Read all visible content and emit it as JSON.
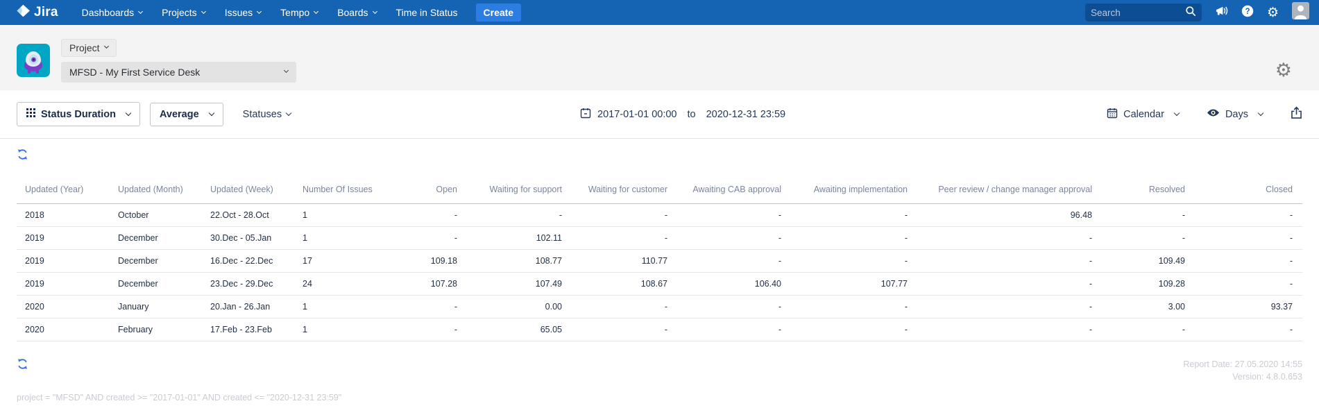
{
  "nav": {
    "logo_text": "Jira",
    "items": [
      {
        "label": "Dashboards"
      },
      {
        "label": "Projects"
      },
      {
        "label": "Issues"
      },
      {
        "label": "Tempo"
      },
      {
        "label": "Boards"
      },
      {
        "label": "Time in Status"
      }
    ],
    "create_label": "Create",
    "search_placeholder": "Search"
  },
  "banner": {
    "scope_label": "Project",
    "project_select_value": "MFSD - My First Service Desk"
  },
  "toolbar": {
    "report_type_label": "Status Duration",
    "aggregation_label": "Average",
    "statuses_label": "Statuses",
    "date_from": "2017-01-01 00:00",
    "date_to_word": "to",
    "date_to": "2020-12-31 23:59",
    "calendar_label": "Calendar",
    "unit_label": "Days"
  },
  "table": {
    "columns": [
      "Updated (Year)",
      "Updated (Month)",
      "Updated (Week)",
      "Number Of Issues",
      "Open",
      "Waiting for support",
      "Waiting for customer",
      "Awaiting CAB approval",
      "Awaiting implementation",
      "Peer review / change manager approval",
      "Resolved",
      "Closed"
    ],
    "rows": [
      [
        "2018",
        "October",
        "22.Oct - 28.Oct",
        "1",
        "-",
        "-",
        "-",
        "-",
        "-",
        "96.48",
        "-",
        "-"
      ],
      [
        "2019",
        "December",
        "30.Dec - 05.Jan",
        "1",
        "-",
        "102.11",
        "-",
        "-",
        "-",
        "-",
        "-",
        "-"
      ],
      [
        "2019",
        "December",
        "16.Dec - 22.Dec",
        "17",
        "109.18",
        "108.77",
        "110.77",
        "-",
        "-",
        "-",
        "109.49",
        "-"
      ],
      [
        "2019",
        "December",
        "23.Dec - 29.Dec",
        "24",
        "107.28",
        "107.49",
        "108.67",
        "106.40",
        "107.77",
        "-",
        "109.28",
        "-"
      ],
      [
        "2020",
        "January",
        "20.Jan - 26.Jan",
        "1",
        "-",
        "0.00",
        "-",
        "-",
        "-",
        "-",
        "3.00",
        "93.37"
      ],
      [
        "2020",
        "February",
        "17.Feb - 23.Feb",
        "1",
        "-",
        "65.05",
        "-",
        "-",
        "-",
        "-",
        "-",
        "-"
      ]
    ]
  },
  "footer": {
    "report_date": "Report Date: 27.05.2020 14:55",
    "version": "Version: 4.8.0.653",
    "jql": "project = \"MFSD\" AND created >= \"2017-01-01\" AND created <= \"2020-12-31 23:59\""
  },
  "icons": {
    "jira_logo": "jira-mark",
    "search": "magnifier",
    "announce": "megaphone",
    "help": "question-circle",
    "settings": "gear ⚙",
    "avatar": "person-silhouette",
    "report_type": "grid-3x3",
    "date": "calendar",
    "calendar_mode": "calendar",
    "unit": "eye",
    "export": "box-arrow-up",
    "refresh": "circular-arrows"
  },
  "colors": {
    "nav_bg": "#1464b3",
    "create_bg": "#2b7de4",
    "search_bg": "#0d4d93",
    "banner_bg": "#f4f4f4",
    "accent_blue": "#3b73e8",
    "avatar_teal": "#00a7c4",
    "text_dark": "#253858",
    "header_muted": "#7a869a",
    "faint_text": "#c9ccd3"
  }
}
